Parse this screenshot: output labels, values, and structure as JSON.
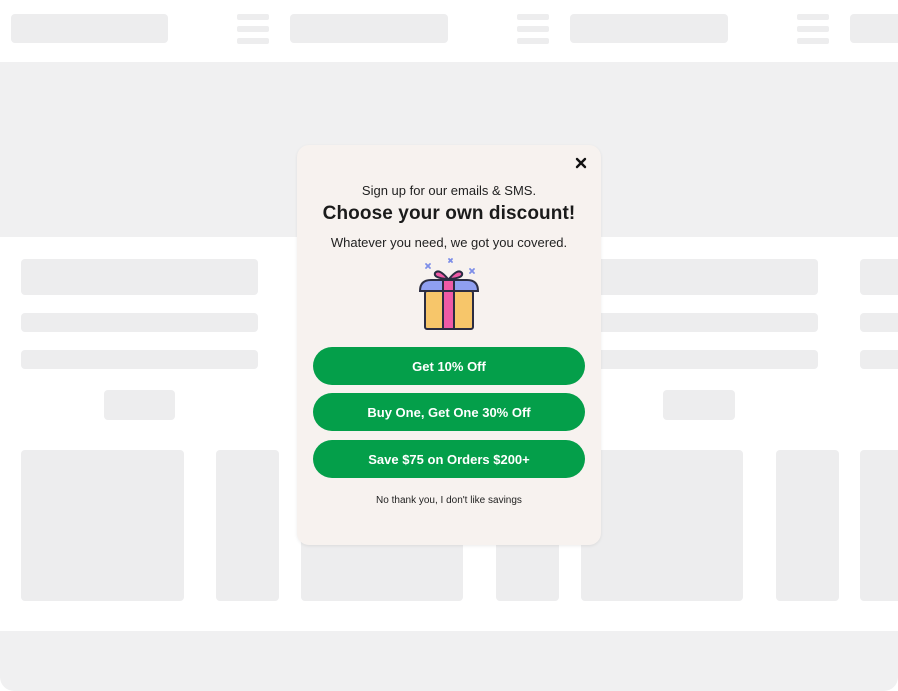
{
  "popup": {
    "close_icon": "close-icon",
    "subtitle": "Sign up for our emails & SMS.",
    "title": "Choose your own discount!",
    "description": "Whatever you need, we got you covered.",
    "illustration": "gift-box-icon",
    "offers": [
      {
        "label": "Get 10% Off"
      },
      {
        "label": "Buy One, Get One 30% Off"
      },
      {
        "label": "Save $75 on Orders $200+"
      }
    ],
    "decline_text": "No thank you, I don't like savings"
  },
  "colors": {
    "button_bg": "#049f4a",
    "popup_bg": "#f7f2ef",
    "placeholder": "#ededee"
  }
}
